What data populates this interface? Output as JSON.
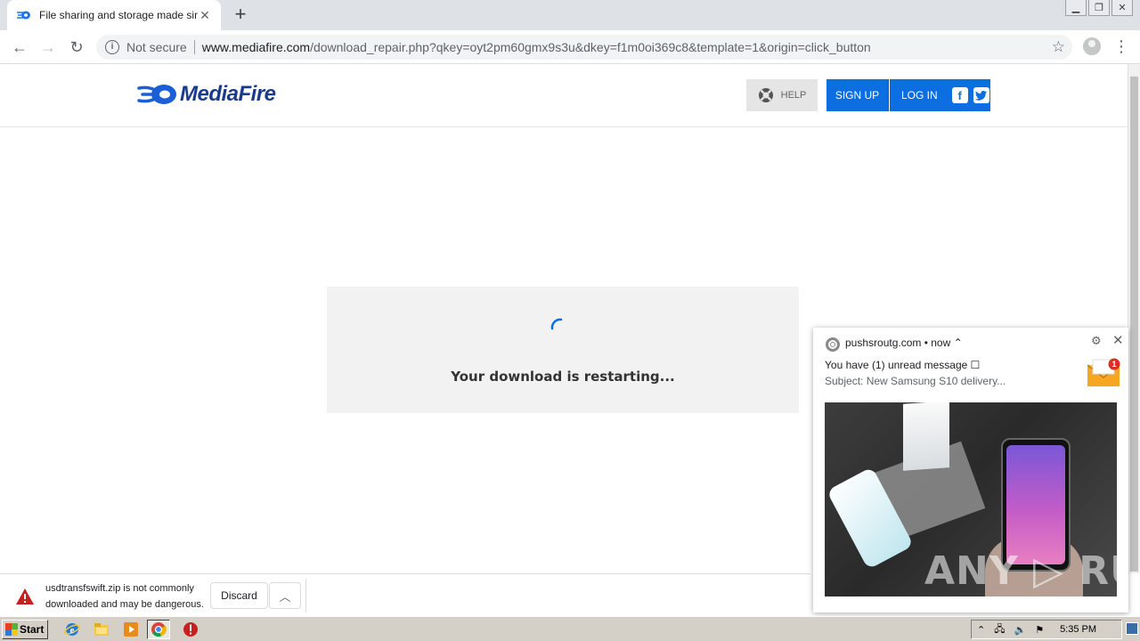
{
  "browser": {
    "tab": {
      "title": "File sharing and storage made simple",
      "favicon": "mediafire-favicon-icon"
    },
    "new_tab_label": "+",
    "address": {
      "security_label": "Not secure",
      "host": "www.mediafire.com",
      "path": "/download_repair.php?qkey=oyt2pm60gmx9s3u&dkey=f1m0oi369c8&template=1&origin=click_button"
    }
  },
  "site": {
    "logo_text": "MediaFire",
    "help_label": "HELP",
    "signup_label": "SIGN UP",
    "login_label": "LOG IN",
    "facebook_label": "f",
    "twitter_label": "t",
    "accent_color": "#0c6ee0"
  },
  "status": {
    "message": "Your download is restarting..."
  },
  "download_bar": {
    "warning_line1": "usdtransfswift.zip is not commonly",
    "warning_line2": "downloaded and may be dangerous.",
    "discard_label": "Discard"
  },
  "notification": {
    "source": "pushsroutg.com • now ⌃",
    "title": "You have (1) unread message ☐",
    "subject": "Subject: New Samsung S10 delivery...",
    "badge_count": "1",
    "watermark": "ANY ▷ RUN"
  },
  "taskbar": {
    "start_label": "Start",
    "clock": "5:35 PM"
  }
}
